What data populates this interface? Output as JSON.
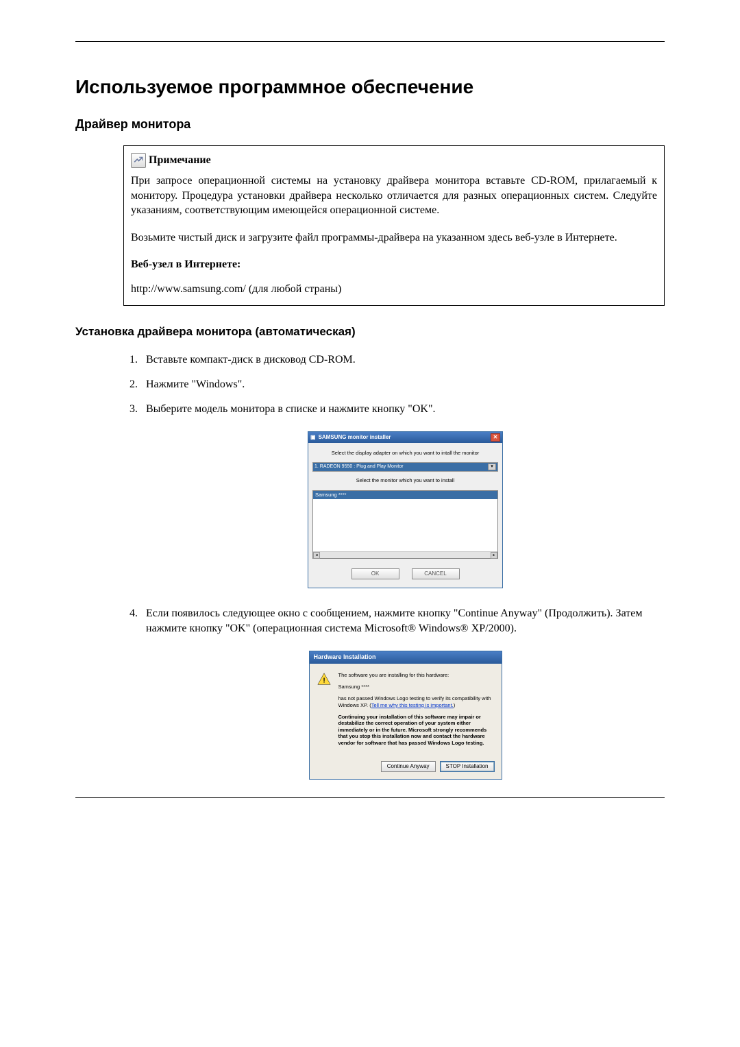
{
  "main_title": "Используемое программное обеспечение",
  "section1": "Драйвер монитора",
  "note": {
    "label": "Примечание",
    "para1": "При запросе операционной системы на установку драйвера монитора вставьте CD-ROM, прилагаемый к монитору. Процедура установки драйвера несколько отличается для разных операционных систем. Следуйте указаниям, соответствующим имеющейся операционной системе.",
    "para2": "Возьмите чистый диск и загрузите файл программы-драйвера на указанном здесь веб-узле в Интернете.",
    "web_label": "Веб-узел в Интернете:",
    "url": "http://www.samsung.com/ (для любой страны)"
  },
  "section2": "Установка драйвера монитора (автоматическая)",
  "steps": {
    "s1": "Вставьте компакт-диск в дисковод CD-ROM.",
    "s2": "Нажмите \"Windows\".",
    "s3": "Выберите модель монитора в списке и нажмите кнопку \"OK\".",
    "s4": "Если появилось следующее окно с сообщением, нажмите кнопку \"Continue Anyway\" (Продолжить). Затем нажмите кнопку \"OK\" (операционная система Microsoft® Windows® XP/2000)."
  },
  "installer": {
    "title": "SAMSUNG monitor installer",
    "instr1": "Select the display adapter on which you want to intall the monitor",
    "dropdown": "1. RADEON 9550 : Plug and Play Monitor",
    "instr2": "Select the monitor which you want to install",
    "list_item": "Samsung ****",
    "ok": "OK",
    "cancel": "CANCEL"
  },
  "hw": {
    "title": "Hardware Installation",
    "line1": "The software you are installing for this hardware:",
    "line2": "Samsung ****",
    "line3a": "has not passed Windows Logo testing to verify its compatibility with Windows XP. (",
    "link": "Tell me why this testing is important.",
    "line3b": ")",
    "warn": "Continuing your installation of this software may impair or destabilize the correct operation of your system either immediately or in the future. Microsoft strongly recommends that you stop this installation now and contact the hardware vendor for software that has passed Windows Logo testing.",
    "cont": "Continue Anyway",
    "stop": "STOP Installation"
  }
}
